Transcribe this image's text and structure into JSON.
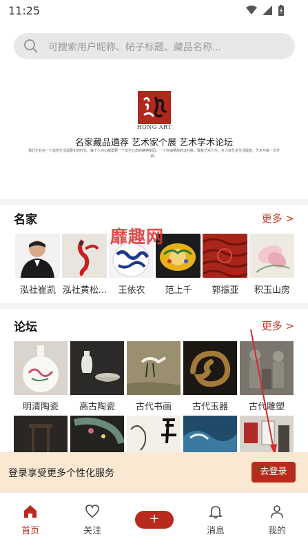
{
  "status": {
    "time": "11:25"
  },
  "search": {
    "placeholder": "可搜索用户昵称、帖子标题、藏品名称..."
  },
  "banner": {
    "logo_text": "HONG ART",
    "slogan": "名家藏品遴荐 艺术家个展 艺术学术论坛",
    "intro": "我们正处在一个鉴赏生活需要化的时代，每个人内心都需要一个安生立命的精神家园，一个自由畅想的远托桃。致敬艺术人生，步入高艺术生活殿堂，艺术与家一见开启。"
  },
  "artists": {
    "title": "名家",
    "more": "更多 >",
    "items": [
      {
        "name": "泓社崔凯",
        "icon": "portrait"
      },
      {
        "name": "泓社黄松...",
        "icon": "red-bird"
      },
      {
        "name": "王依农",
        "icon": "blue-white-vase"
      },
      {
        "name": "范上千",
        "icon": "yellow-bowl"
      },
      {
        "name": "郭振亚",
        "icon": "carved-lacquer"
      },
      {
        "name": "积玉山房",
        "icon": "lotus-painting"
      }
    ]
  },
  "watermark": "靡趣网",
  "forum": {
    "title": "论坛",
    "more": "更多 >",
    "items": [
      {
        "name": "明清陶瓷",
        "icon": "flask-vase"
      },
      {
        "name": "高古陶瓷",
        "icon": "white-vase"
      },
      {
        "name": "古代书画",
        "icon": "crane-painting"
      },
      {
        "name": "古代玉器",
        "icon": "jade-dragon"
      },
      {
        "name": "古代雕塑",
        "icon": "stone-relief"
      }
    ],
    "second_row": [
      {
        "icon": "dark-furniture"
      },
      {
        "icon": "embroidered-textile"
      },
      {
        "icon": "calligraphy-scroll"
      },
      {
        "icon": "seascape-painting"
      },
      {
        "icon": "gallery-room"
      }
    ]
  },
  "login": {
    "text": "登录享受更多个性化服务",
    "button": "去登录"
  },
  "tabs": [
    {
      "label": "首页",
      "icon": "home-icon",
      "active": true
    },
    {
      "label": "关注",
      "icon": "heart-icon"
    },
    {
      "label": "+",
      "icon": "plus-icon"
    },
    {
      "label": "消息",
      "icon": "bell-icon"
    },
    {
      "label": "我的",
      "icon": "user-icon"
    }
  ],
  "colors": {
    "accent": "#b82a1c",
    "login_bg": "#fbe8d2",
    "more": "#c23a26"
  }
}
